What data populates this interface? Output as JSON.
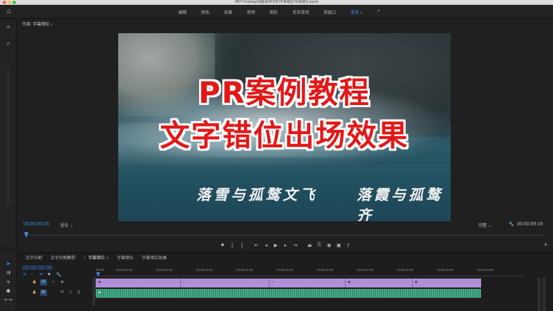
{
  "window": {
    "title": "/用户/zhuilesg/桌面/素材文件/字幕错位/字幕错位.prproj"
  },
  "workspaces": {
    "items": [
      "编辑",
      "颜色",
      "效果",
      "音频",
      "图形",
      "老朱常用",
      "双窗口",
      "老朱"
    ],
    "active_index": 7,
    "more": "»"
  },
  "monitor": {
    "panel_title": "节目: 字幕错位",
    "headline_line1": "PR案例教程",
    "headline_line2": "文字错位出场效果",
    "subtitle_left": "落雪与孤鹜文飞",
    "subtitle_right": "落霞与孤鹜齐",
    "timecode_current": "00:00:00:05",
    "fit_label": "适合",
    "quality_label": "完整",
    "timecode_duration": "00:00:09:19",
    "playhead_position": 0.0
  },
  "timeline": {
    "tabs": [
      "文字分割",
      "文字分割教程",
      "字幕错位",
      "字幕错位",
      "字幕错位效果"
    ],
    "active_tab_index": 2,
    "timecode": "00:00:00:05",
    "ruler_ticks": [
      ":00:00",
      "00:00:01:00",
      "00:00:02:00",
      "00:00:03:00",
      "00:00:04:00",
      "00:00:05:00",
      "00:00:06:00",
      "00:00:07:00",
      "00:00:08:00",
      "00:00:09:00",
      "00:00:10:00"
    ],
    "tracks": {
      "video": {
        "id": "V1",
        "source": "V1"
      },
      "audio": {
        "id": "A1",
        "source": "A1",
        "m": "M",
        "s": "S"
      }
    }
  },
  "colors": {
    "accent": "#3b8ef0",
    "video_clip": "#b08fd8",
    "audio_clip": "#2e8c6b",
    "headline_red": "#e21818"
  }
}
